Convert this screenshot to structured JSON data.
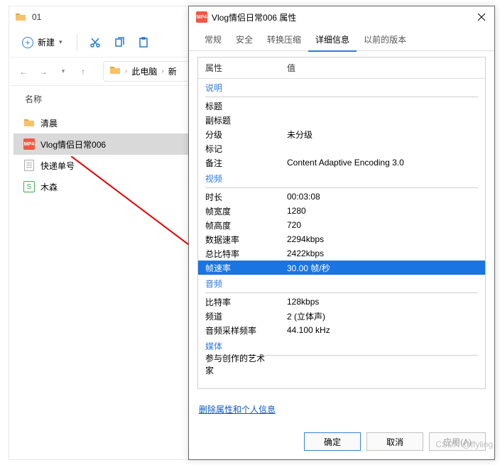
{
  "explorer": {
    "title": "01",
    "toolbar": {
      "new_label": "新建"
    },
    "breadcrumb": {
      "pc": "此电脑",
      "next": "新"
    },
    "column_header": "名称",
    "items": [
      {
        "name": "清晨",
        "type": "folder"
      },
      {
        "name": "Vlog情侣日常006",
        "type": "mp4",
        "selected": true
      },
      {
        "name": "快递单号",
        "type": "doc"
      },
      {
        "name": "木森",
        "type": "s"
      }
    ]
  },
  "props": {
    "title": "Vlog情侣日常006 属性",
    "tabs": [
      "常规",
      "安全",
      "转换压缩",
      "详细信息",
      "以前的版本"
    ],
    "active_tab": "详细信息",
    "header": {
      "prop": "属性",
      "val": "值"
    },
    "sections": {
      "desc": {
        "title": "说明",
        "rows": [
          {
            "k": "标题",
            "v": ""
          },
          {
            "k": "副标题",
            "v": ""
          },
          {
            "k": "分级",
            "v": "未分级"
          },
          {
            "k": "标记",
            "v": ""
          },
          {
            "k": "备注",
            "v": "Content Adaptive Encoding 3.0"
          }
        ]
      },
      "video": {
        "title": "视频",
        "rows": [
          {
            "k": "时长",
            "v": "00:03:08"
          },
          {
            "k": "帧宽度",
            "v": "1280"
          },
          {
            "k": "帧高度",
            "v": "720"
          },
          {
            "k": "数据速率",
            "v": "2294kbps"
          },
          {
            "k": "总比特率",
            "v": "2422kbps"
          },
          {
            "k": "帧速率",
            "v": "30.00 帧/秒",
            "highlighted": true
          }
        ]
      },
      "audio": {
        "title": "音频",
        "rows": [
          {
            "k": "比特率",
            "v": "128kbps"
          },
          {
            "k": "频道",
            "v": "2 (立体声)"
          },
          {
            "k": "音频采样频率",
            "v": "44.100 kHz"
          }
        ]
      },
      "media": {
        "title": "媒体",
        "rows": [
          {
            "k": "参与创作的艺术家",
            "v": ""
          }
        ]
      }
    },
    "link": "删除属性和个人信息",
    "buttons": {
      "ok": "确定",
      "cancel": "取消",
      "apply": "应用(A)"
    }
  },
  "watermark": "CSDN @ffyling"
}
